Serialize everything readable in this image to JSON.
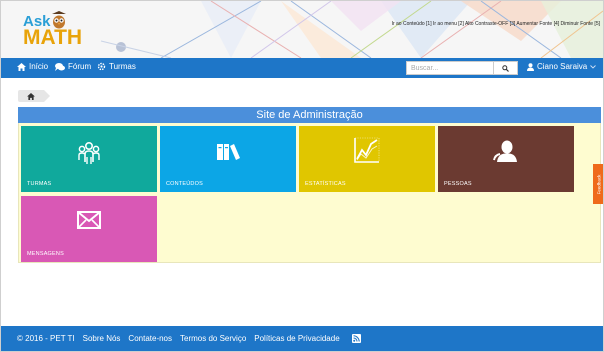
{
  "header": {
    "logo_top": "Ask",
    "logo_bottom": "MATH",
    "accessibility_bar": "Ir ao Conteúdo [1] Ir ao menu [2] Alto Contraste-OFF [3] Aumentar Fonte [4] Diminuir Fonte [5]"
  },
  "nav": {
    "home": "Início",
    "forum": "Fórum",
    "turmas": "Turmas",
    "search_placeholder": "Buscar...",
    "user": "Ciano Saraiva"
  },
  "main": {
    "title": "Site de Administração",
    "tiles": [
      {
        "label": "TURMAS",
        "color": "#10a99c",
        "icon": "users-group-icon"
      },
      {
        "label": "CONTEÚDOS",
        "color": "#0ca6e6",
        "icon": "books-icon"
      },
      {
        "label": "ESTATÍSTICAS",
        "color": "#e0c600",
        "icon": "line-chart-icon"
      },
      {
        "label": "PESSOAS",
        "color": "#6b3a31",
        "icon": "person-icon"
      },
      {
        "label": "MENSAGENS",
        "color": "#d958b5",
        "icon": "envelope-icon"
      }
    ]
  },
  "feedback": "Feedback",
  "footer": {
    "copyright": "© 2016 - PET TI",
    "links": [
      "Sobre Nós",
      "Contate-nos",
      "Termos do Serviço",
      "Políticas de Privacidade"
    ]
  },
  "colors": {
    "navbar": "#1e76c8",
    "panel_title": "#4b8fdb",
    "panel_bg": "#fefcd0",
    "feedback": "#ef6a1a"
  }
}
